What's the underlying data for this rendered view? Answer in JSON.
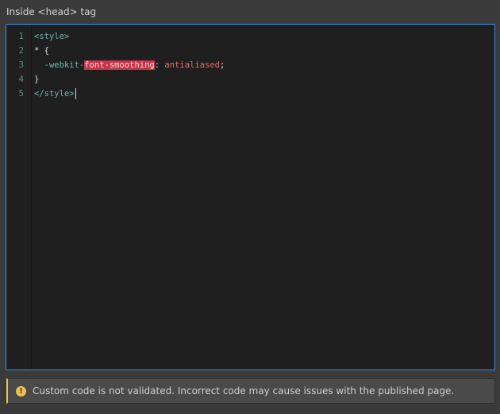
{
  "label": "Inside <head> tag",
  "editor": {
    "line_numbers": [
      "1",
      "2",
      "3",
      "4",
      "5"
    ],
    "lines": {
      "l1": "<style>",
      "l2": "* {",
      "l3_indent": "  ",
      "l3_prefix": "-webkit-",
      "l3_highlight": "font-smoothing",
      "l3_colon": ": ",
      "l3_value": "antialiased",
      "l3_semi": ";",
      "l4": "}",
      "l5": "</style>"
    }
  },
  "warning": {
    "icon": "exclamation-circle-icon",
    "icon_glyph": "!",
    "text": "Custom code is not validated. Incorrect code may cause issues with the published page.",
    "color": "#f2c14a"
  }
}
